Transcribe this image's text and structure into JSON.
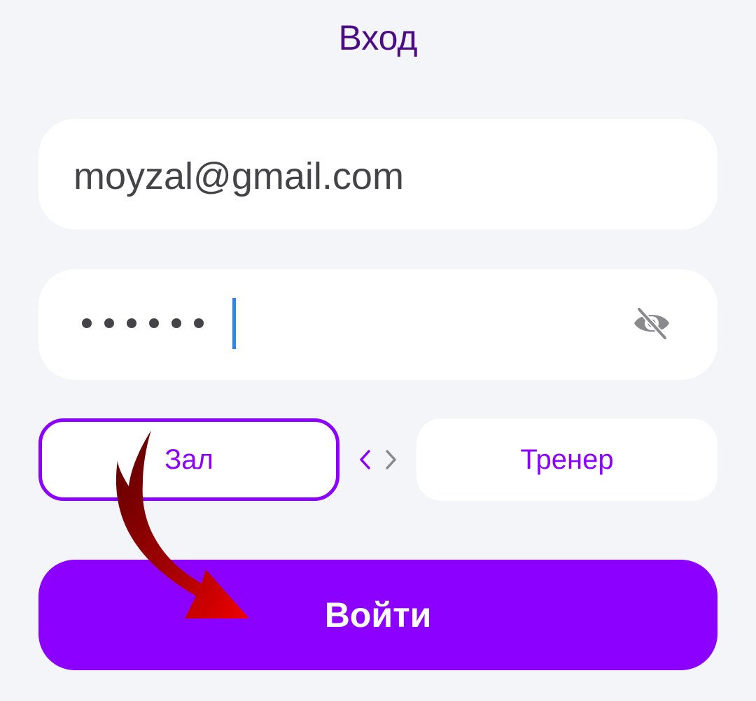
{
  "header": {
    "title": "Вход"
  },
  "form": {
    "email": {
      "value": "moyzal@gmail.com"
    },
    "password": {
      "masked_length": 6,
      "visibility_icon": "eye-slash-icon"
    },
    "roles": {
      "gym_label": "Зал",
      "trainer_label": "Тренер",
      "selected": "Зал",
      "switch_icon": "chevron-left-right-icon"
    },
    "submit_label": "Войти"
  },
  "annotation": {
    "arrow_icon": "red-curved-arrow-icon"
  },
  "colors": {
    "background": "#f4f5f9",
    "accent": "#8b00ff",
    "title": "#4b0c86",
    "text": "#444448",
    "caret": "#2f86e6",
    "annotation_arrow": "#e00000"
  }
}
